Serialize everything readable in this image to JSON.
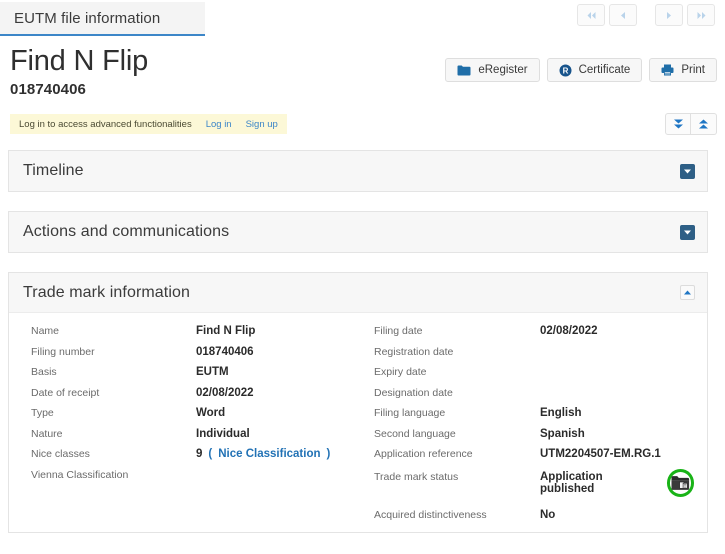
{
  "tab": {
    "label": "EUTM file information"
  },
  "pager": {
    "first": {
      "name": "first-page",
      "glyph": "◀◀"
    },
    "prev": {
      "name": "previous-page",
      "glyph": "◀"
    },
    "next": {
      "name": "next-page",
      "glyph": "▶"
    },
    "last": {
      "name": "last-page",
      "glyph": "▶▶"
    }
  },
  "header": {
    "title": "Find N Flip",
    "number": "018740406"
  },
  "actions": [
    {
      "label": "eRegister",
      "icon": "folder-icon"
    },
    {
      "label": "Certificate",
      "icon": "registered-mark-icon"
    },
    {
      "label": "Print",
      "icon": "printer-icon"
    }
  ],
  "login_banner": {
    "message": "Log in to access advanced functionalities",
    "login_label": "Log in",
    "signup_label": "Sign up"
  },
  "expand_controls": {
    "expand_all_label": "Expand all",
    "collapse_all_label": "Collapse all"
  },
  "sections": [
    {
      "title": "Timeline",
      "state": "collapsed"
    },
    {
      "title": "Actions and communications",
      "state": "collapsed"
    },
    {
      "title": "Trade mark information",
      "state": "expanded"
    }
  ],
  "trade_mark_information": {
    "left": [
      {
        "label": "Name",
        "value": "Find N Flip"
      },
      {
        "label": "Filing number",
        "value": "018740406"
      },
      {
        "label": "Basis",
        "value": "EUTM"
      },
      {
        "label": "Date of receipt",
        "value": "02/08/2022"
      },
      {
        "label": "Type",
        "value": "Word"
      },
      {
        "label": "Nature",
        "value": "Individual"
      },
      {
        "label": "Nice classes",
        "value": "9",
        "link": "Nice Classification"
      },
      {
        "label": "Vienna Classification",
        "value": ""
      }
    ],
    "right": [
      {
        "label": "Filing date",
        "value": "02/08/2022"
      },
      {
        "label": "Registration date",
        "value": ""
      },
      {
        "label": "Expiry date",
        "value": ""
      },
      {
        "label": "Designation date",
        "value": ""
      },
      {
        "label": "Filing language",
        "value": "English"
      },
      {
        "label": "Second language",
        "value": "Spanish"
      },
      {
        "label": "Application reference",
        "value": "UTM2204507-EM.RG.1"
      },
      {
        "label": "Trade mark status",
        "value": "Application published",
        "icon": "folder-documents-icon"
      },
      {
        "label": "Acquired distinctiveness",
        "value": "No"
      }
    ]
  },
  "colors": {
    "tab_accent": "#3c86c8",
    "link": "#2272b5",
    "toggle_dark": "#2e5f86",
    "banner_bg": "#fcf8d7",
    "highlight_ring": "#19b317"
  }
}
